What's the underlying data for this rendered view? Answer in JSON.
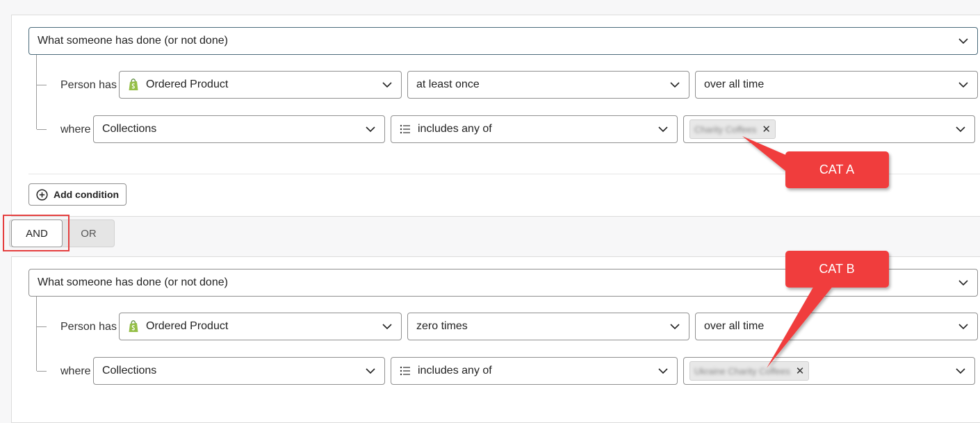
{
  "filter_groups": [
    {
      "definition_type": "What someone has done (or not done)",
      "person_has_label": "Person has",
      "metric": "Ordered Product",
      "frequency": "at least once",
      "time_range": "over all time",
      "where_label": "where",
      "property": "Collections",
      "operator": "includes any of",
      "value_tag": "Charity Coffees"
    },
    {
      "definition_type": "What someone has done (or not done)",
      "person_has_label": "Person has",
      "metric": "Ordered Product",
      "frequency": "zero times",
      "time_range": "over all time",
      "where_label": "where",
      "property": "Collections",
      "operator": "includes any of",
      "value_tag": "Ukraine Charity Coffees"
    }
  ],
  "add_condition_label": "Add condition",
  "logic_toggle": {
    "and_label": "AND",
    "or_label": "OR",
    "selected": "AND"
  },
  "annotations": {
    "callout_a": "CAT A",
    "callout_b": "CAT B"
  },
  "icons": {
    "metric_icon": "shopify-bag-icon",
    "operator_icon": "list-icon",
    "dropdown_icon": "chevron-down-icon",
    "add_icon": "plus-circle-icon",
    "remove_icon": "close-icon"
  },
  "colors": {
    "shopify_green": "#95bf47",
    "callout_red": "#f03e3e",
    "highlight_red": "#e53e3e"
  }
}
